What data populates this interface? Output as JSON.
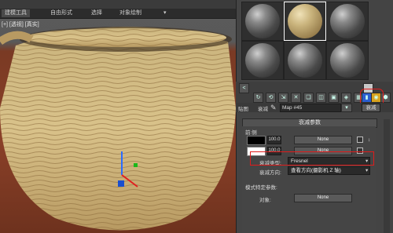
{
  "viewport": {
    "label": "[+] [透视] [真实]",
    "tabs": [
      "建模工具",
      "自由形式",
      "选择",
      "对象绘制"
    ],
    "tab_small": "▾"
  },
  "material_editor": {
    "map_label": "贴图",
    "map_prefix": "衰减",
    "map_name": "Map #45",
    "map_type_button": "衰减",
    "rollout_title": "衰减参数",
    "section_front_side": "前:侧",
    "row1": {
      "value": "100.0",
      "map": "None"
    },
    "row2": {
      "value": "100.0",
      "map": "None"
    },
    "falloff_type_label": "衰减类型:",
    "falloff_type_value": "Fresnel",
    "falloff_dir_label": "衰减方向:",
    "falloff_dir_value": "查看方向(摄影机 Z 轴)",
    "mode_params_title": "模式特定参数:",
    "object_label": "对象:",
    "object_value": "None",
    "scroll_button": "<"
  },
  "colors": {
    "highlight": "#e01b1b",
    "wood_light": "#d9c28a",
    "wood_dark": "#8a6a3a",
    "floor": "#8a4028"
  }
}
